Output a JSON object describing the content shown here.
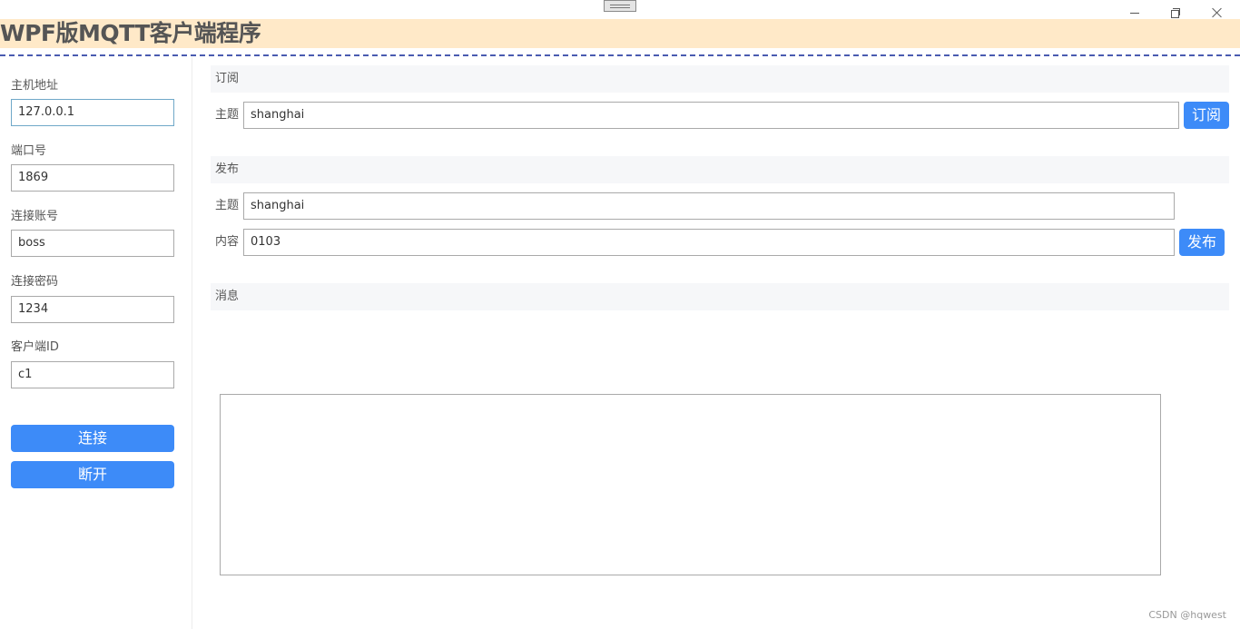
{
  "app_title": "WPF版MQTT客户端程序",
  "window_controls": {
    "minimize": "minimize-icon",
    "restore": "restore-icon",
    "close": "close-icon"
  },
  "sidebar": {
    "host_label": "主机地址",
    "host_value": "127.0.0.1",
    "port_label": "端口号",
    "port_value": "1869",
    "account_label": "连接账号",
    "account_value": "boss",
    "password_label": "连接密码",
    "password_value": "1234",
    "client_id_label": "客户端ID",
    "client_id_value": "c1",
    "connect_label": "连接",
    "disconnect_label": "断开"
  },
  "subscribe": {
    "section_title": "订阅",
    "topic_label": "主题",
    "topic_value": "shanghai",
    "button_label": "订阅"
  },
  "publish": {
    "section_title": "发布",
    "topic_label": "主题",
    "topic_value": "shanghai",
    "content_label": "内容",
    "content_value": "0103",
    "button_label": "发布"
  },
  "messages": {
    "section_title": "消息",
    "content": ""
  },
  "watermark": "CSDN @hqwest",
  "colors": {
    "header_bg": "#ffe9c8",
    "accent": "#3d8bf8",
    "divider": "#4a5bb0"
  }
}
